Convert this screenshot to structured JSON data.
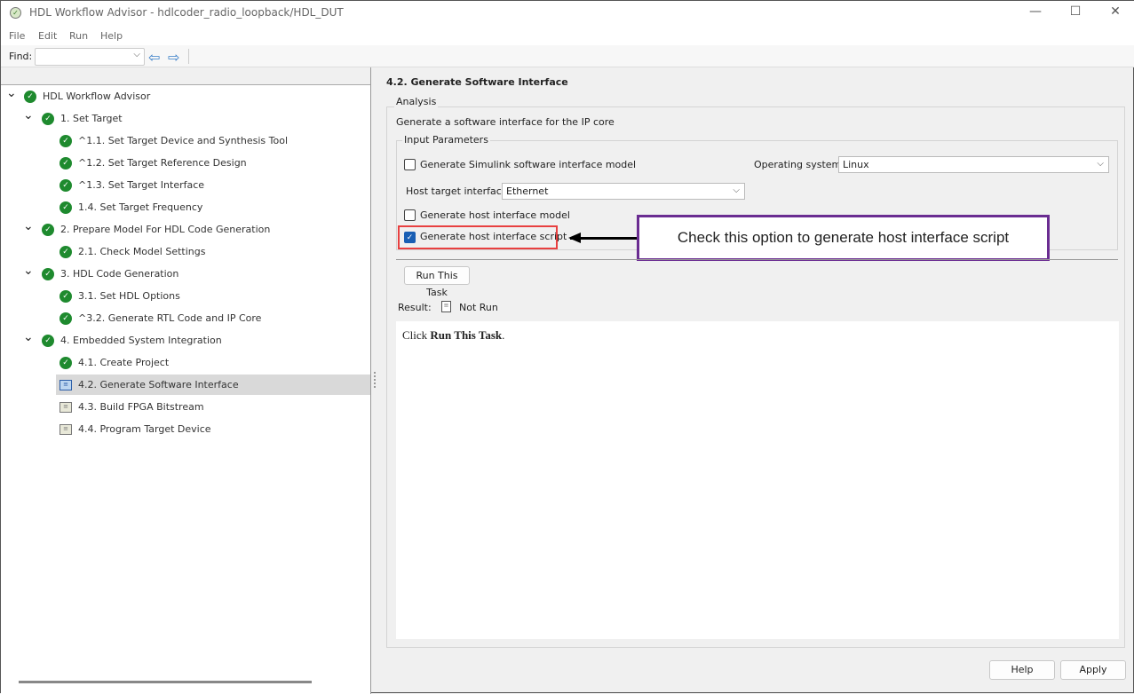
{
  "window": {
    "title": "HDL Workflow Advisor - hdlcoder_radio_loopback/HDL_DUT",
    "minimize": "—",
    "maximize": "☐",
    "close": "✕"
  },
  "menu": [
    "File",
    "Edit",
    "Run",
    "Help"
  ],
  "toolbar": {
    "find_label": "Find:",
    "find_value": ""
  },
  "tree": [
    {
      "label": "HDL Workflow Advisor",
      "level": 0,
      "status": "passed",
      "expanded": true
    },
    {
      "label": "1. Set Target",
      "level": 1,
      "status": "passed",
      "expanded": true
    },
    {
      "label": "^1.1. Set Target Device and Synthesis Tool",
      "level": 2,
      "status": "passed"
    },
    {
      "label": "^1.2. Set Target Reference Design",
      "level": 2,
      "status": "passed"
    },
    {
      "label": "^1.3. Set Target Interface",
      "level": 2,
      "status": "passed"
    },
    {
      "label": "1.4. Set Target Frequency",
      "level": 2,
      "status": "passed"
    },
    {
      "label": "2. Prepare Model For HDL Code Generation",
      "level": 1,
      "status": "passed",
      "expanded": true
    },
    {
      "label": "2.1. Check Model Settings",
      "level": 2,
      "status": "passed"
    },
    {
      "label": "3. HDL Code Generation",
      "level": 1,
      "status": "passed",
      "expanded": true
    },
    {
      "label": "3.1. Set HDL Options",
      "level": 2,
      "status": "passed"
    },
    {
      "label": "^3.2. Generate RTL Code and IP Core",
      "level": 2,
      "status": "passed"
    },
    {
      "label": "4. Embedded System Integration",
      "level": 1,
      "status": "passed",
      "expanded": true
    },
    {
      "label": "4.1. Create Project",
      "level": 2,
      "status": "passed"
    },
    {
      "label": "4.2. Generate Software Interface",
      "level": 2,
      "status": "current",
      "selected": true
    },
    {
      "label": "4.3. Build FPGA Bitstream",
      "level": 2,
      "status": "not-run"
    },
    {
      "label": "4.4. Program Target Device",
      "level": 2,
      "status": "not-run"
    }
  ],
  "task": {
    "title": "4.2. Generate Software Interface",
    "analysis_label": "Analysis",
    "description": "Generate a software interface for the IP core",
    "input_params_label": "Input Parameters",
    "gen_simulink_label": "Generate Simulink software interface model",
    "gen_simulink_checked": false,
    "os_label": "Operating system:",
    "os_value": "Linux",
    "host_iface_label": "Host target interface",
    "host_iface_value": "Ethernet",
    "gen_host_model_label": "Generate host interface model",
    "gen_host_model_checked": false,
    "gen_host_script_label": "Generate host interface script",
    "gen_host_script_checked": true,
    "run_button": "Run This Task",
    "result_label": "Result:",
    "result_value": "Not Run",
    "output_prefix": "Click ",
    "output_bold": "Run This Task",
    "output_suffix": "."
  },
  "callout": {
    "text": "Check this option to generate host interface script",
    "border_color": "#6a2c91",
    "highlight_color": "#e84040"
  },
  "footer": {
    "help": "Help",
    "apply": "Apply"
  }
}
